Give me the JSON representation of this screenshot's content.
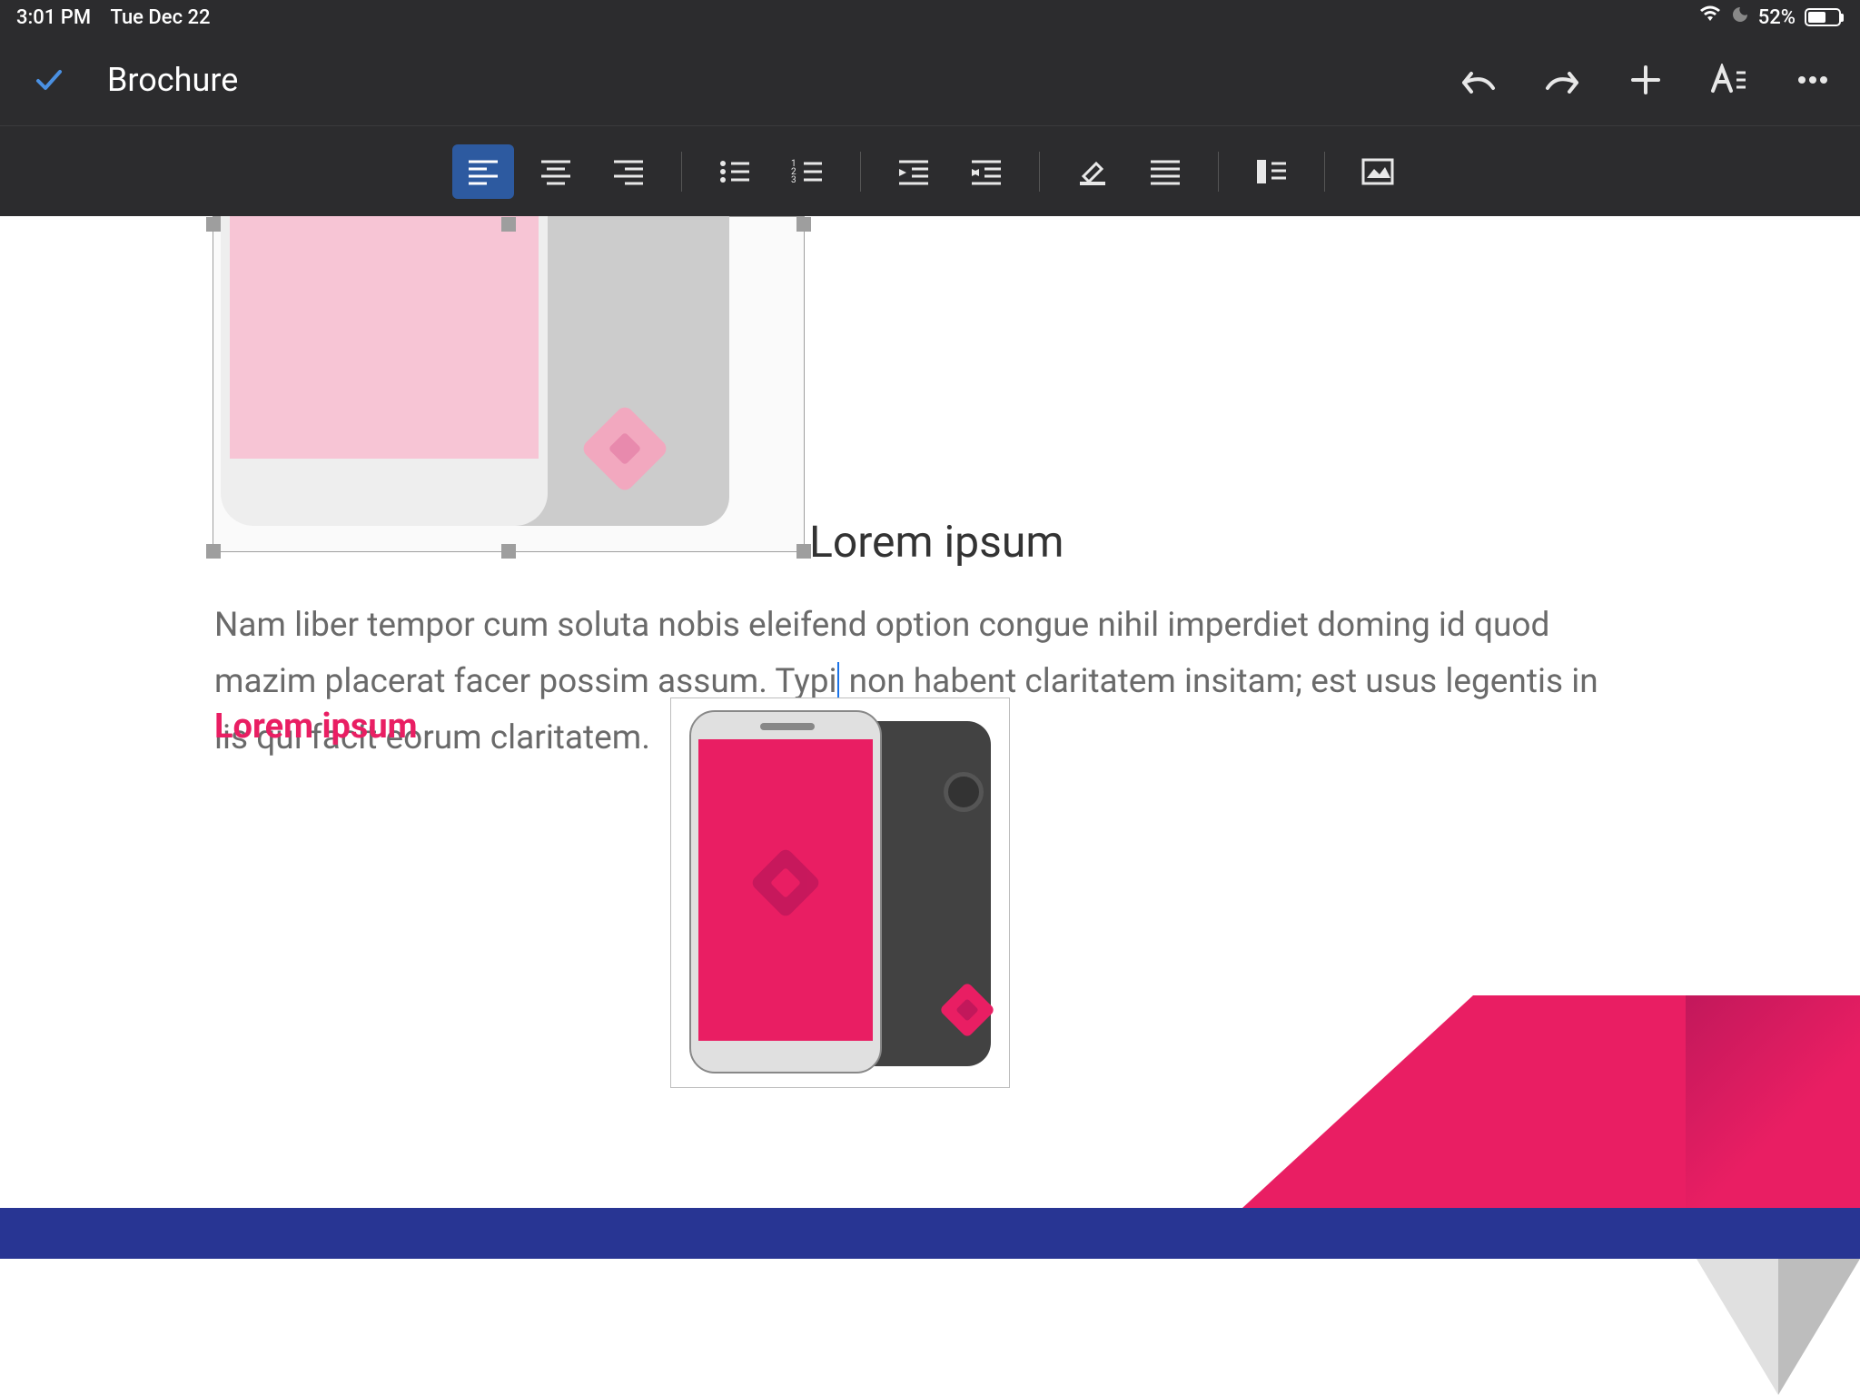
{
  "status": {
    "time": "3:01 PM",
    "date": "Tue Dec 22",
    "battery_pct": "52%"
  },
  "header": {
    "title": "Brochure"
  },
  "document": {
    "heading1": "Lorem ipsum",
    "body_before_cursor": "Nam liber tempor cum soluta nobis eleifend option congue nihil imperdiet doming id quod mazim placerat facer possim assum. Typi",
    "body_after_cursor": " non habent claritatem insitam; est usus legentis in iis qui facit eorum claritatem.",
    "heading2": "Lorem ipsum"
  },
  "colors": {
    "accent_pink": "#e91e63",
    "accent_blue": "#283593",
    "toolbar_active": "#2d5aa0"
  }
}
